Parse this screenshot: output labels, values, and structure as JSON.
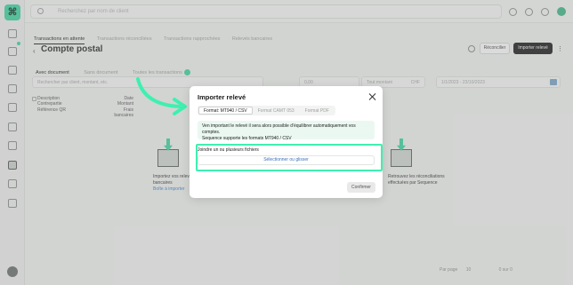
{
  "app": {
    "logo_glyph": "⌘",
    "accent": "#3fd6a2"
  },
  "topbar": {
    "search_placeholder": "Recherchez par nom de client"
  },
  "subtabs": [
    {
      "label": "Transactions en attente"
    },
    {
      "label": "Transactions réconciliées"
    },
    {
      "label": "Transactions rapprochées"
    },
    {
      "label": "Relevés bancaires"
    }
  ],
  "page": {
    "title": "Compte postal",
    "reconcile_label": "Réconcilier",
    "import_label": "Importer relevé"
  },
  "filter_tabs": [
    {
      "label": "Avec document"
    },
    {
      "label": "Sans document"
    },
    {
      "label": "Toutes les transactions"
    }
  ],
  "filters": {
    "search_placeholder": "Rechercher par client, montant, etc.",
    "amount_min": "0,00",
    "amount_label": "Tout montant",
    "currency": "CHF",
    "date_range": "1/1/2023 - 23/10/2023"
  },
  "table_headers": {
    "left": [
      "Description",
      "Contrepartie",
      "Référence QR"
    ],
    "right": [
      "Date",
      "Montant",
      "Frais bancaires"
    ]
  },
  "empty_left": {
    "line1": "Importez vos relevés",
    "line2": "bancaires",
    "link": "Boîte à importer"
  },
  "empty_right": {
    "line1": "Retrouvez les réconciliations",
    "line2": "effectuées par Sequence"
  },
  "pager": {
    "per_page_label": "Par page",
    "per_page": "10",
    "range": "0 sur 0"
  },
  "modal": {
    "title": "Importer relevé",
    "tabs": [
      {
        "label": "Format: MT940 / CSV"
      },
      {
        "label": "Format CAMT 053"
      },
      {
        "label": "Format PDF"
      }
    ],
    "info_line1": "Ven important le relevé il sera alors possible d'équilibrer automatiquement vos comptes.",
    "info_line2": "Sequence supporte les formats MT940 / CSV",
    "join_label": "Joindre un ou plusieurs fichiers",
    "drop_label": "Sélectionner ou glisser",
    "confirm_label": "Confirmer"
  }
}
